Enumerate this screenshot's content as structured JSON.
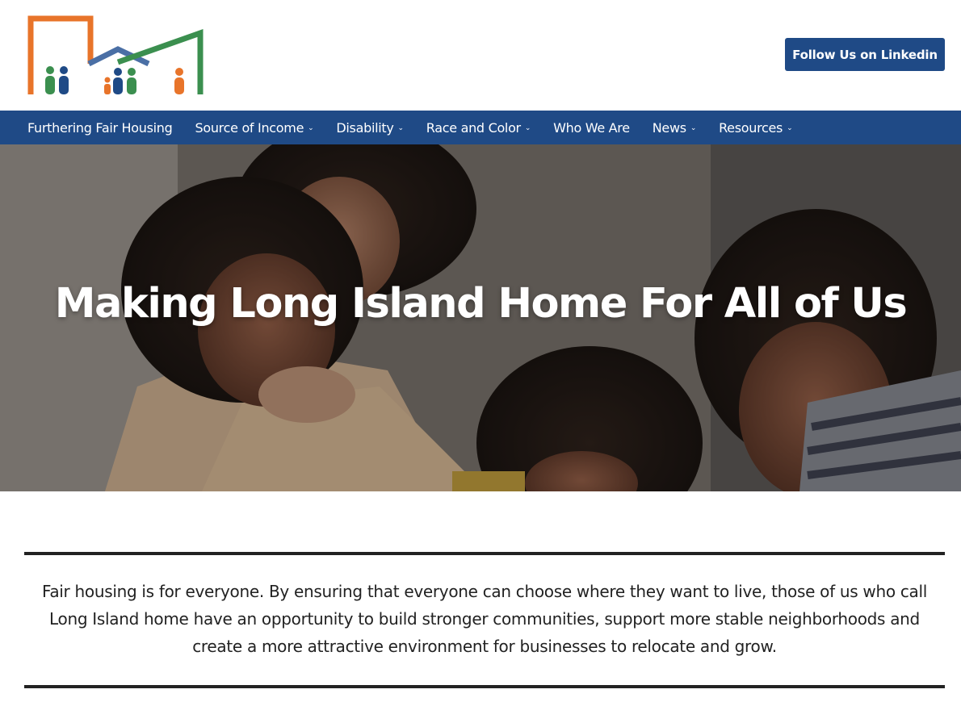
{
  "header": {
    "logo_icon": "fair-housing-logo-icon",
    "follow_button_label": "Follow Us on Linkedin"
  },
  "nav": {
    "items": [
      {
        "label": "Furthering Fair Housing",
        "has_dropdown": false
      },
      {
        "label": "Source of Income",
        "has_dropdown": true
      },
      {
        "label": "Disability",
        "has_dropdown": true
      },
      {
        "label": "Race and Color",
        "has_dropdown": true
      },
      {
        "label": "Who We Are",
        "has_dropdown": false
      },
      {
        "label": "News",
        "has_dropdown": true
      },
      {
        "label": "Resources",
        "has_dropdown": true
      }
    ],
    "chevron_glyph": "⌄"
  },
  "hero": {
    "title": "Making Long Island Home For All of Us",
    "image": "family-hug-photo"
  },
  "intro": {
    "text": "Fair housing is for everyone. By ensuring that everyone can choose where they want to live, those of us who call Long Island home have an opportunity to build stronger communities, support more stable neighborhoods and create a more attractive environment for businesses to relocate and grow."
  },
  "colors": {
    "brand_blue": "#1f4a86",
    "logo_orange": "#e8742a",
    "logo_green": "#3b8f4f",
    "logo_blue": "#4a6fa5",
    "rule": "#222222"
  }
}
